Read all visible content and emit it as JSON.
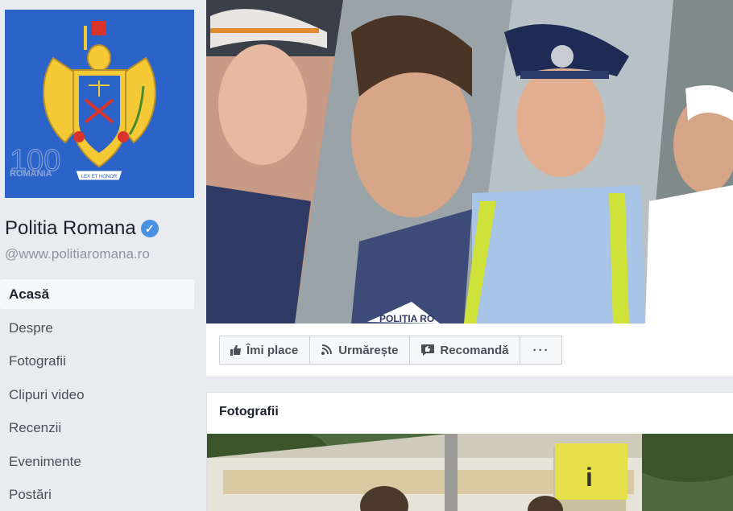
{
  "page": {
    "name": "Politia Romana",
    "handle": "@www.politiaromana.ro",
    "verified_mark": "✓"
  },
  "logo": {
    "number": "100",
    "country": "ROMÂNIA",
    "tagline": "LEX ET HONOR"
  },
  "nav": {
    "items": [
      {
        "label": "Acasă",
        "active": true
      },
      {
        "label": "Despre"
      },
      {
        "label": "Fotografii"
      },
      {
        "label": "Clipuri video"
      },
      {
        "label": "Recenzii"
      },
      {
        "label": "Evenimente"
      },
      {
        "label": "Postări"
      }
    ]
  },
  "actions": {
    "like": "Îmi place",
    "follow": "Urmărește",
    "recommend": "Recomandă",
    "more": "···"
  },
  "cover": {
    "badge_text": "POLIȚIA RO"
  },
  "photos": {
    "title": "Fotografii"
  },
  "colors": {
    "brand_blue": "#2b63c8",
    "verified_blue": "#4a90e2",
    "crest_gold": "#f4c935"
  },
  "icons": [
    "thumbs-up-icon",
    "rss-icon",
    "recommend-icon",
    "verified-icon"
  ]
}
